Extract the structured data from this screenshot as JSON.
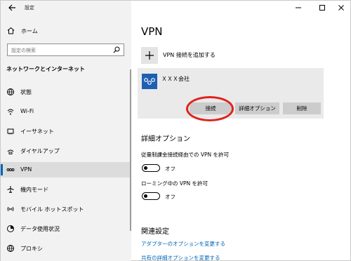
{
  "window": {
    "title": "設定",
    "controls": [
      "minimize-icon",
      "maximize-icon",
      "close-icon"
    ]
  },
  "sidebar": {
    "home_label": "ホーム",
    "search_placeholder": "設定の検索",
    "section_heading": "ネットワークとインターネット",
    "items": [
      {
        "label": "状態",
        "icon": "globe-icon",
        "selected": false
      },
      {
        "label": "Wi-Fi",
        "icon": "wifi-icon",
        "selected": false
      },
      {
        "label": "イーサネット",
        "icon": "ethernet-icon",
        "selected": false
      },
      {
        "label": "ダイヤルアップ",
        "icon": "dialup-icon",
        "selected": false
      },
      {
        "label": "VPN",
        "icon": "vpn-icon",
        "selected": true
      },
      {
        "label": "機内モード",
        "icon": "airplane-icon",
        "selected": false
      },
      {
        "label": "モバイル ホットスポット",
        "icon": "hotspot-icon",
        "selected": false
      },
      {
        "label": "データ使用状況",
        "icon": "data-usage-icon",
        "selected": false
      },
      {
        "label": "プロキシ",
        "icon": "globe-icon",
        "selected": false
      }
    ]
  },
  "main": {
    "title": "VPN",
    "add_vpn_label": "VPN 接続を追加する",
    "connection": {
      "name": "ＸＸＸ会社",
      "buttons": {
        "connect": "接続",
        "advanced": "詳細オプション",
        "delete": "削除"
      }
    },
    "advanced": {
      "heading": "詳細オプション",
      "metered_label": "従量制課金接続経由での VPN を許可",
      "metered_state": "オフ",
      "roaming_label": "ローミング中の VPN を許可",
      "roaming_state": "オフ"
    },
    "related": {
      "heading": "関連設定",
      "link1": "アダプターのオプションを変更する",
      "link2": "共有の詳細オプションを変更する"
    }
  },
  "colors": {
    "accent": "#0063b1",
    "link": "#0066b4",
    "highlight": "#e0221b",
    "vpn_tile": "#1e5fb3"
  }
}
